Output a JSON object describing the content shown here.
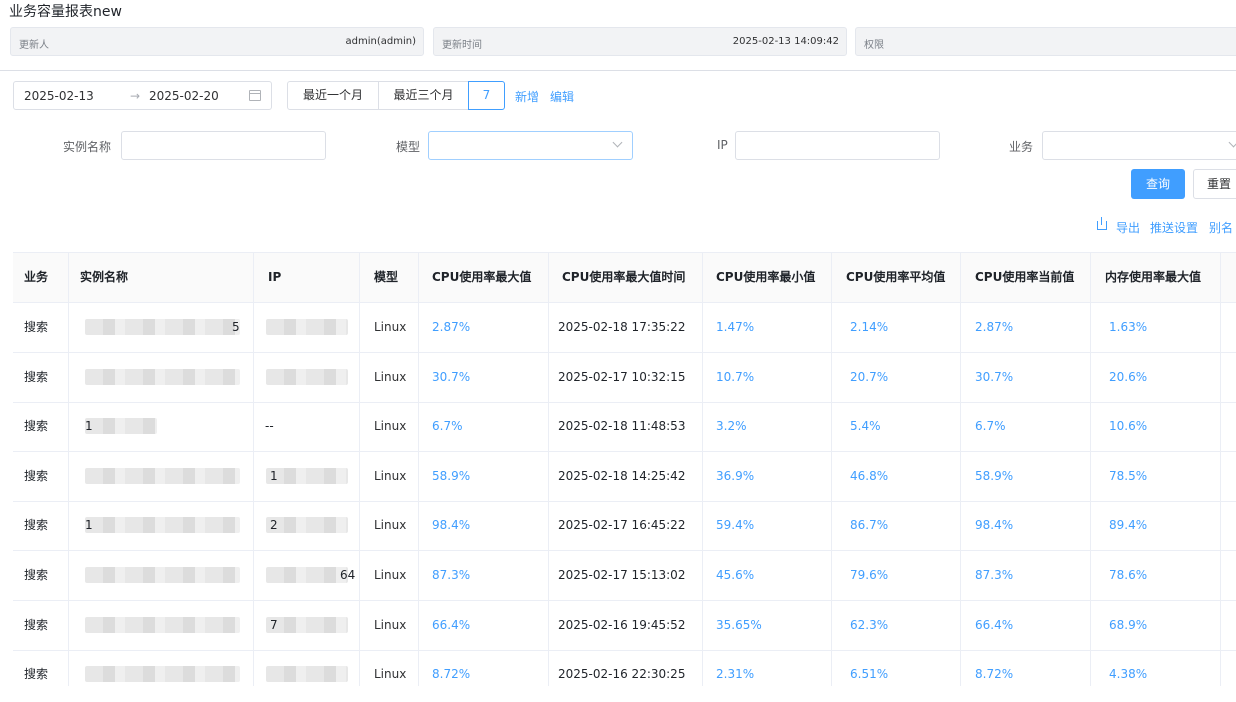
{
  "page_title": "业务容量报表new",
  "meta": {
    "updater": {
      "label": "更新人",
      "value": "admin(admin)"
    },
    "update_time": {
      "label": "更新时间",
      "value": "2025-02-13 14:09:42"
    },
    "permission": {
      "label": "权限"
    }
  },
  "toolbar": {
    "start_date": "2025-02-13",
    "arrow": "→",
    "end_date": "2025-02-20",
    "range_last_month": "最近一个月",
    "range_last_three_months": "最近三个月",
    "range_days": "7",
    "add": "新增",
    "edit": "编辑"
  },
  "filters": {
    "instance_name": "实例名称",
    "model": "模型",
    "ip": "IP",
    "business": "业务"
  },
  "actions": {
    "query": "查询",
    "reset": "重置",
    "export": "导出",
    "push_settings": "推送设置",
    "alias": "别名"
  },
  "table": {
    "columns": [
      "业务",
      "实例名称",
      "IP",
      "模型",
      "CPU使用率最大值",
      "CPU使用率最大值时间",
      "CPU使用率最小值",
      "CPU使用率平均值",
      "CPU使用率当前值",
      "内存使用率最大值"
    ],
    "rows": [
      {
        "business": "搜索",
        "name_visible": "5",
        "ip_visible": "",
        "model": "Linux",
        "cpu_max": "2.87%",
        "cpu_max_time": "2025-02-18 17:35:22",
        "cpu_min": "1.47%",
        "cpu_avg": "2.14%",
        "cpu_cur": "2.87%",
        "mem_max": "1.63%"
      },
      {
        "business": "搜索",
        "name_visible": "",
        "ip_visible": "",
        "model": "Linux",
        "cpu_max": "30.7%",
        "cpu_max_time": "2025-02-17 10:32:15",
        "cpu_min": "10.7%",
        "cpu_avg": "20.7%",
        "cpu_cur": "30.7%",
        "mem_max": "20.6%"
      },
      {
        "business": "搜索",
        "name_visible": "1",
        "ip_visible": "--",
        "model": "Linux",
        "cpu_max": "6.7%",
        "cpu_max_time": "2025-02-18 11:48:53",
        "cpu_min": "3.2%",
        "cpu_avg": "5.4%",
        "cpu_cur": "6.7%",
        "mem_max": "10.6%"
      },
      {
        "business": "搜索",
        "name_visible": "",
        "ip_visible": "1",
        "model": "Linux",
        "cpu_max": "58.9%",
        "cpu_max_time": "2025-02-18 14:25:42",
        "cpu_min": "36.9%",
        "cpu_avg": "46.8%",
        "cpu_cur": "58.9%",
        "mem_max": "78.5%"
      },
      {
        "business": "搜索",
        "name_visible": "1",
        "ip_visible": "2",
        "model": "Linux",
        "cpu_max": "98.4%",
        "cpu_max_time": "2025-02-17 16:45:22",
        "cpu_min": "59.4%",
        "cpu_avg": "86.7%",
        "cpu_cur": "98.4%",
        "mem_max": "89.4%"
      },
      {
        "business": "搜索",
        "name_visible": "",
        "ip_visible": "64",
        "model": "Linux",
        "cpu_max": "87.3%",
        "cpu_max_time": "2025-02-17 15:13:02",
        "cpu_min": "45.6%",
        "cpu_avg": "79.6%",
        "cpu_cur": "87.3%",
        "mem_max": "78.6%"
      },
      {
        "business": "搜索",
        "name_visible": "",
        "ip_visible": "7",
        "model": "Linux",
        "cpu_max": "66.4%",
        "cpu_max_time": "2025-02-16 19:45:52",
        "cpu_min": "35.65%",
        "cpu_avg": "62.3%",
        "cpu_cur": "66.4%",
        "mem_max": "68.9%"
      },
      {
        "business": "搜索",
        "name_visible": "",
        "ip_visible": "",
        "model": "Linux",
        "cpu_max": "8.72%",
        "cpu_max_time": "2025-02-16 22:30:25",
        "cpu_min": "2.31%",
        "cpu_avg": "6.51%",
        "cpu_cur": "8.72%",
        "mem_max": "4.38%"
      }
    ]
  },
  "colors": {
    "accent": "#409eff",
    "border": "#dcdfe6",
    "header_bg": "#fafafa"
  }
}
